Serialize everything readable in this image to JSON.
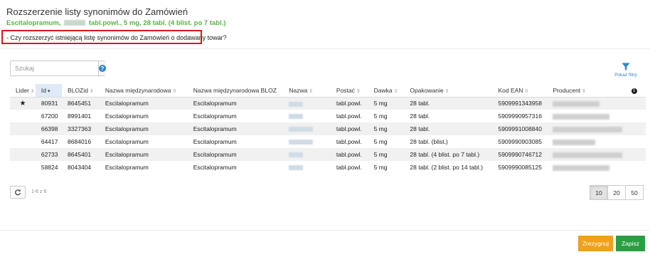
{
  "dialog": {
    "title": "Rozszerzenie listy synonimów do Zamówień",
    "subtitle_prefix": "Escitalopramum,",
    "subtitle_suffix": "tabl.powl., 5 mg, 28 tabl. (4 blist. po 7 tabl.)",
    "question": "- Czy rozszerzyć istniejącą listę synonimów do Zamówień o dodawany towar?"
  },
  "search": {
    "placeholder": "Szukaj",
    "help_icon": "question-circle-icon"
  },
  "filter": {
    "label": "Pokaż filtry",
    "icon": "funnel-icon",
    "color": "#2f84c6"
  },
  "table": {
    "columns": [
      {
        "label": "Lider",
        "sortable": true
      },
      {
        "label": "Id",
        "sortable": true,
        "sorted": "desc"
      },
      {
        "label": "BLOZid",
        "sortable": true
      },
      {
        "label": "Nazwa międzynarodowa",
        "sortable": true
      },
      {
        "label": "Nazwa międzynarodowa BLOZ",
        "sortable": false
      },
      {
        "label": "Nazwa",
        "sortable": true
      },
      {
        "label": "Postać",
        "sortable": true
      },
      {
        "label": "Dawka",
        "sortable": true
      },
      {
        "label": "Opakowanie",
        "sortable": true
      },
      {
        "label": "Kod EAN",
        "sortable": true
      },
      {
        "label": "Producent",
        "sortable": true
      }
    ],
    "rows": [
      {
        "lider": true,
        "id": "80931",
        "blozid": "8645451",
        "nazwa_miedzynarodowa": "Escitalopramum",
        "nazwa_bloz": "Escitalopramum",
        "postac": "tabl.powl.",
        "dawka": "5 mg",
        "opakowanie": "28 tabl.",
        "ean": "5909991343958"
      },
      {
        "lider": false,
        "id": "67200",
        "blozid": "8991401",
        "nazwa_miedzynarodowa": "Escitalopramum",
        "nazwa_bloz": "Escitalopramum",
        "postac": "tabl.powl.",
        "dawka": "5 mg",
        "opakowanie": "28 tabl.",
        "ean": "5909990957316"
      },
      {
        "lider": false,
        "id": "66398",
        "blozid": "3327363",
        "nazwa_miedzynarodowa": "Escitalopramum",
        "nazwa_bloz": "Escitalopramum",
        "postac": "tabl.powl.",
        "dawka": "5 mg",
        "opakowanie": "28 tabl.",
        "ean": "5909991008840"
      },
      {
        "lider": false,
        "id": "64417",
        "blozid": "8684016",
        "nazwa_miedzynarodowa": "Escitalopramum",
        "nazwa_bloz": "Escitalopramum",
        "postac": "tabl.powl.",
        "dawka": "5 mg",
        "opakowanie": "28 tabl. (blist.)",
        "ean": "5909990903085"
      },
      {
        "lider": false,
        "id": "62733",
        "blozid": "8645401",
        "nazwa_miedzynarodowa": "Escitalopramum",
        "nazwa_bloz": "Escitalopramum",
        "postac": "tabl.powl.",
        "dawka": "5 mg",
        "opakowanie": "28 tabl. (4 blist. po 7 tabl.)",
        "ean": "5909990746712"
      },
      {
        "lider": false,
        "id": "58824",
        "blozid": "8043404",
        "nazwa_miedzynarodowa": "Escitalopramum",
        "nazwa_bloz": "Escitalopramum",
        "postac": "tabl.powl.",
        "dawka": "5 mg",
        "opakowanie": "28 tabl. (2 blist. po 14 tabl.)",
        "ean": "5909990085125"
      }
    ]
  },
  "pager": {
    "info": "1-6 z 6",
    "page_sizes": [
      "10",
      "20",
      "50"
    ],
    "active_page_size": "10"
  },
  "footer": {
    "cancel_label": "Zrezygnuj",
    "save_label": "Zapisz",
    "cancel_color": "#f0a019",
    "save_color": "#2b9e43"
  }
}
